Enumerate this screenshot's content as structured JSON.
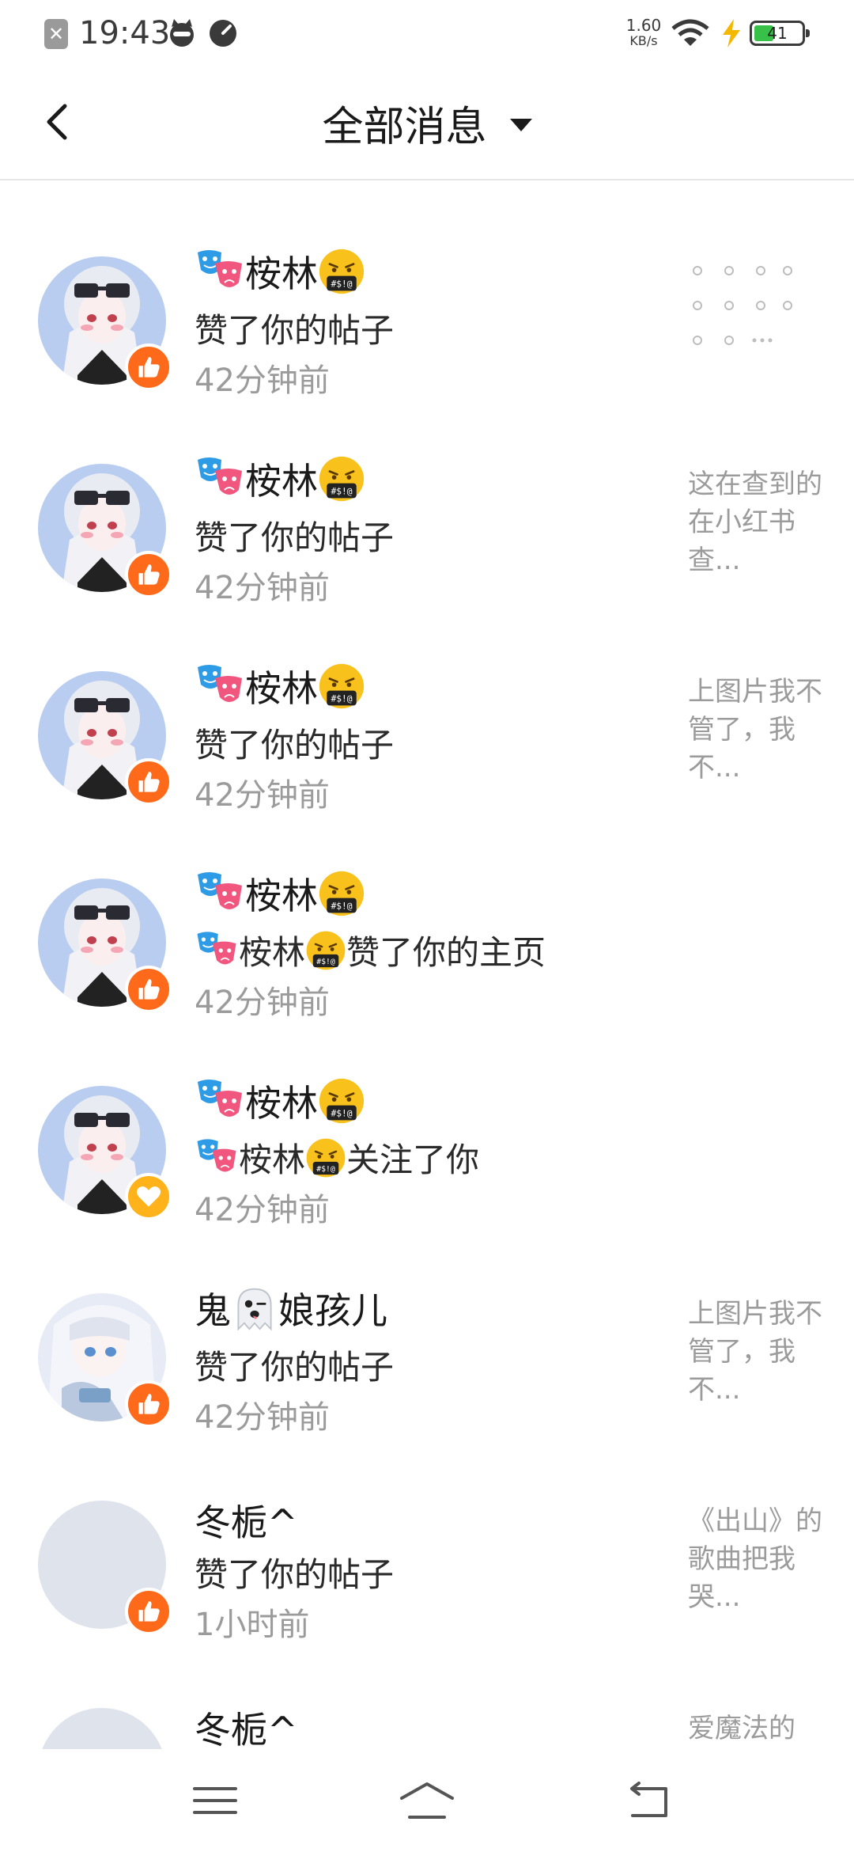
{
  "status_bar": {
    "time": "19:43",
    "speed_value": "1.60",
    "speed_unit": "KB/s",
    "battery": "41",
    "battery_level_percent": 41
  },
  "header": {
    "title": "全部消息"
  },
  "list": {
    "items": [
      {
        "name": "桉林",
        "action": "赞了你的帖子",
        "time": "42分钟前",
        "preview": "",
        "badge": "like"
      },
      {
        "name": "桉林",
        "action": "赞了你的帖子",
        "time": "42分钟前",
        "preview": "这在查到的在小红书查...",
        "badge": "like"
      },
      {
        "name": "桉林",
        "action": "赞了你的帖子",
        "time": "42分钟前",
        "preview": "上图片我不管了，我不...",
        "badge": "like"
      },
      {
        "name": "桉林",
        "action_prefix": "桉林",
        "action": "赞了你的主页",
        "time": "42分钟前",
        "preview": "",
        "badge": "like"
      },
      {
        "name": "桉林",
        "action_prefix": "桉林",
        "action": "关注了你",
        "time": "42分钟前",
        "preview": "",
        "badge": "follow"
      },
      {
        "name_before": "鬼",
        "name_after": "娘孩儿",
        "action": "赞了你的帖子",
        "time": "42分钟前",
        "preview": "上图片我不管了，我不...",
        "badge": "like"
      },
      {
        "name": "冬栀^",
        "action": "赞了你的帖子",
        "time": "1小时前",
        "preview": "《出山》的歌曲把我哭...",
        "badge": "like"
      },
      {
        "name": "冬栀^",
        "action": "",
        "time": "",
        "preview": "爱魔法的",
        "badge": ""
      }
    ]
  },
  "colors": {
    "like_badge": "#ff6a1a",
    "follow_badge": "#ffb21a",
    "secondary_text": "#9b9b9b"
  }
}
